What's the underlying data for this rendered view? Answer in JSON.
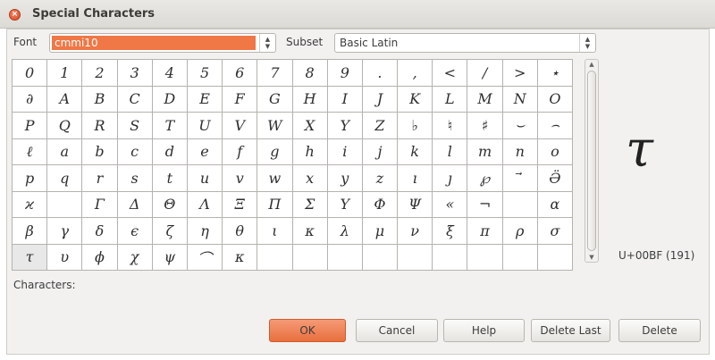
{
  "window": {
    "title": "Special Characters"
  },
  "font": {
    "label": "Font",
    "value": "cmmi10"
  },
  "subset": {
    "label": "Subset",
    "value": "Basic Latin"
  },
  "grid": [
    [
      "0",
      "1",
      "2",
      "3",
      "4",
      "5",
      "6",
      "7",
      "8",
      "9",
      ".",
      ",",
      "<",
      "/",
      ">",
      "⋆"
    ],
    [
      "∂",
      "A",
      "B",
      "C",
      "D",
      "E",
      "F",
      "G",
      "H",
      "I",
      "J",
      "K",
      "L",
      "M",
      "N",
      "O"
    ],
    [
      "P",
      "Q",
      "R",
      "S",
      "T",
      "U",
      "V",
      "W",
      "X",
      "Y",
      "Z",
      "♭",
      "♮",
      "♯",
      "⌣",
      "⌢"
    ],
    [
      "ℓ",
      "a",
      "b",
      "c",
      "d",
      "e",
      "f",
      "g",
      "h",
      "i",
      "j",
      "k",
      "l",
      "m",
      "n",
      "o"
    ],
    [
      "p",
      "q",
      "r",
      "s",
      "t",
      "u",
      "v",
      "w",
      "x",
      "y",
      "z",
      "ı",
      "ȷ",
      "℘",
      "⃗",
      "Ӛ"
    ],
    [
      "ϰ",
      "",
      "Γ",
      "Δ",
      "Θ",
      "Λ",
      "Ξ",
      "Π",
      "Σ",
      "Υ",
      "Φ",
      "Ψ",
      "«",
      "¬",
      "",
      "α"
    ],
    [
      "β",
      "γ",
      "δ",
      "ϵ",
      "ζ",
      "η",
      "θ",
      "ι",
      "κ",
      "λ",
      "μ",
      "ν",
      "ξ",
      "π",
      "ρ",
      "σ"
    ],
    [
      "τ",
      "υ",
      "ϕ",
      "χ",
      "ψ",
      "⌒",
      "κ",
      "",
      "",
      "",
      "",
      "",
      "",
      "",
      "",
      ""
    ]
  ],
  "preview": {
    "glyph": "τ",
    "code": "U+00BF (191)"
  },
  "characters_label": "Characters:",
  "buttons": {
    "ok": "OK",
    "cancel": "Cancel",
    "help": "Help",
    "delete_last": "Delete Last",
    "delete": "Delete"
  }
}
